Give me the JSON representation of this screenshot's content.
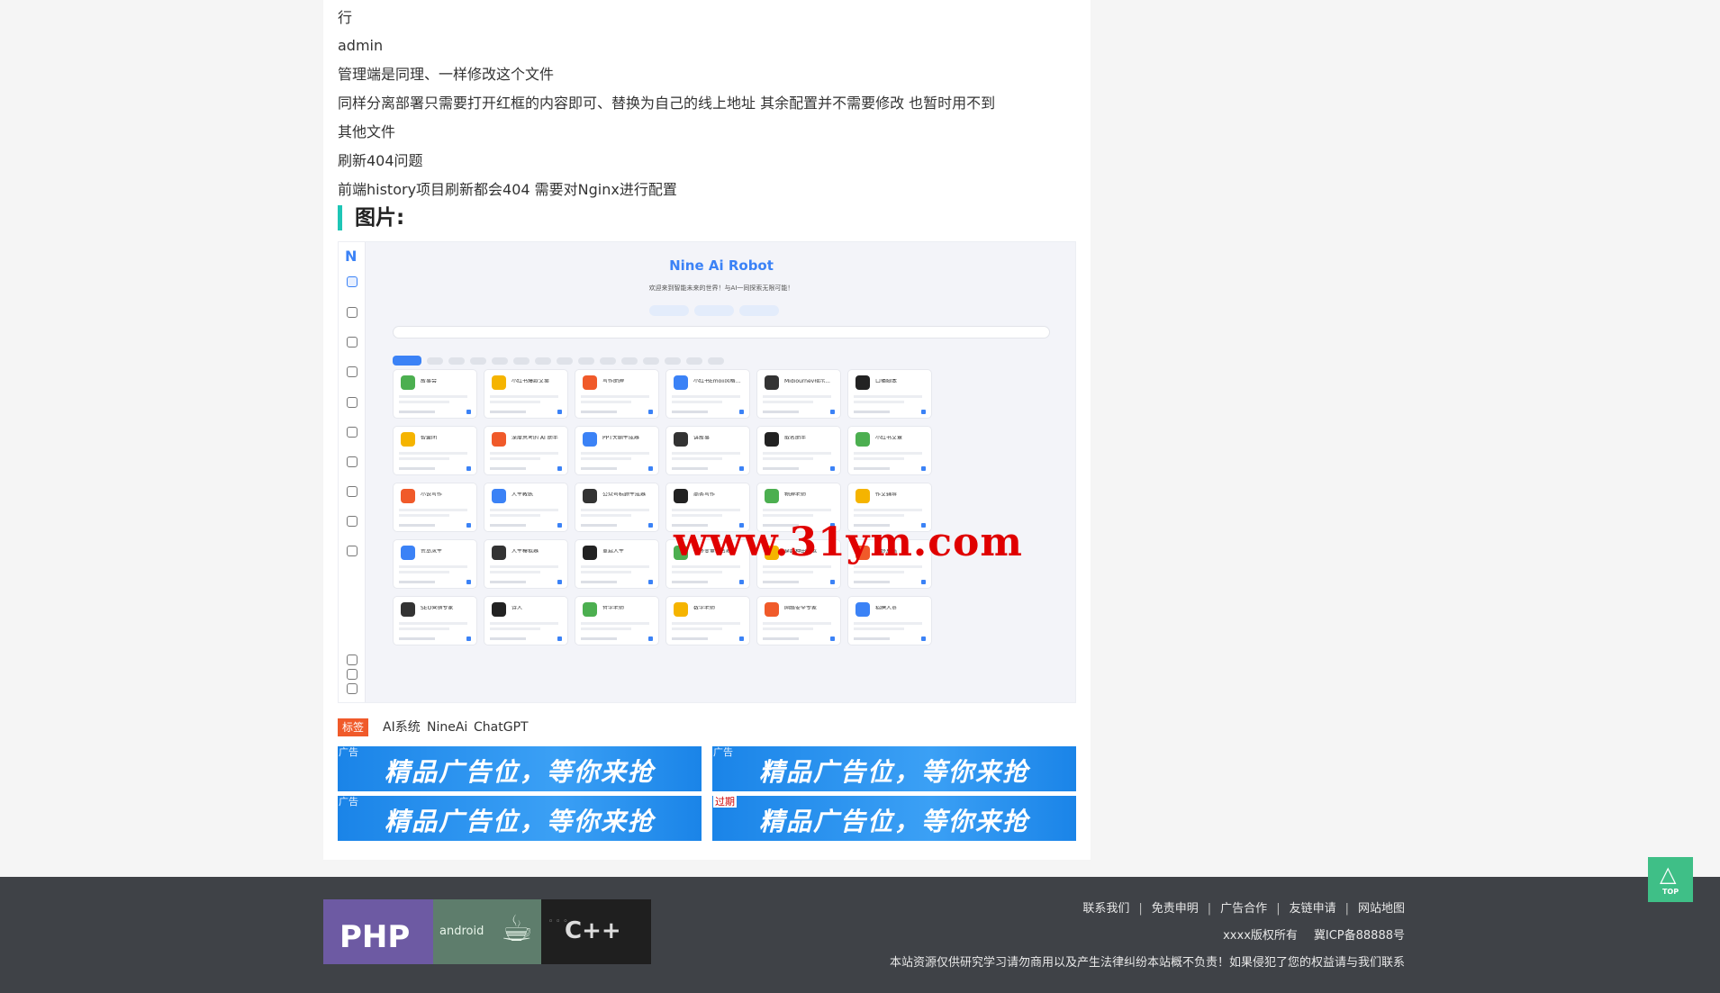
{
  "article": {
    "paragraphs": [
      "行",
      "admin",
      "管理端是同理、一样修改这个文件",
      "同样分离部署只需要打开红框的内容即可、替换为自己的线上地址 其余配置并不需要修改 也暂时用不到",
      "其他文件",
      "刷新404问题",
      "前端history项目刷新都会404 需要对Nginx进行配置"
    ],
    "section_heading": "图片:"
  },
  "screenshot": {
    "app_title": "Nine Ai Robot",
    "subtitle": "欢迎来到智能未来的世界！与AI一同探索无限可能！",
    "card_titles": [
      [
        "故事会",
        "小红书爆款文案",
        "写作助理",
        "小红书Emoji风格...",
        "Midjourney指示...",
        "口播脚本"
      ],
      [
        "智囊团",
        "深度思考的 AI 助手",
        "PPT大纲生成器",
        "讲故事",
        "取名助手",
        "小红书文章"
      ],
      [
        "小说写作",
        "人生教练",
        "公众号标题生成器",
        "商务写作",
        "物理老师",
        "作文辅导"
      ],
      [
        "荒岛求生",
        "人生模拟器",
        "重启人生",
        "韧终变量命名器",
        "穿越种田模拟",
        "年终总结"
      ],
      [
        "SEO营销专家",
        "诗人",
        "哲学老师",
        "数学老师",
        "网络安全专家",
        "招聘人员"
      ]
    ],
    "icon_colors": [
      "#4caf50",
      "#f5b400",
      "#f05a2a",
      "#3b82f6",
      "#333333",
      "#222222"
    ],
    "watermark": "www.31ym.com"
  },
  "tags": {
    "badge": "标签",
    "items": [
      "AI系统",
      "NineAi",
      "ChatGPT"
    ]
  },
  "ads": [
    {
      "text": "精品广告位，等你来抢",
      "label": "广告"
    },
    {
      "text": "精品广告位，等你来抢",
      "label": "广告"
    },
    {
      "text": "精品广告位，等你来抢",
      "label": "广告"
    },
    {
      "text": "精品广告位，等你来抢",
      "label": "过期"
    }
  ],
  "footer": {
    "logos": {
      "php": "PHP",
      "android": "android",
      "cpp": "C++"
    },
    "links": [
      "联系我们",
      "免责申明",
      "广告合作",
      "友链申请",
      "网站地图"
    ],
    "copyright": "xxxx版权所有",
    "icp": "冀ICP备88888号",
    "disclaimer": "本站资源仅供研究学习请勿商用以及产生法律纠纷本站概不负责！如果侵犯了您的权益请与我们联系"
  },
  "back_to_top": "TOP"
}
